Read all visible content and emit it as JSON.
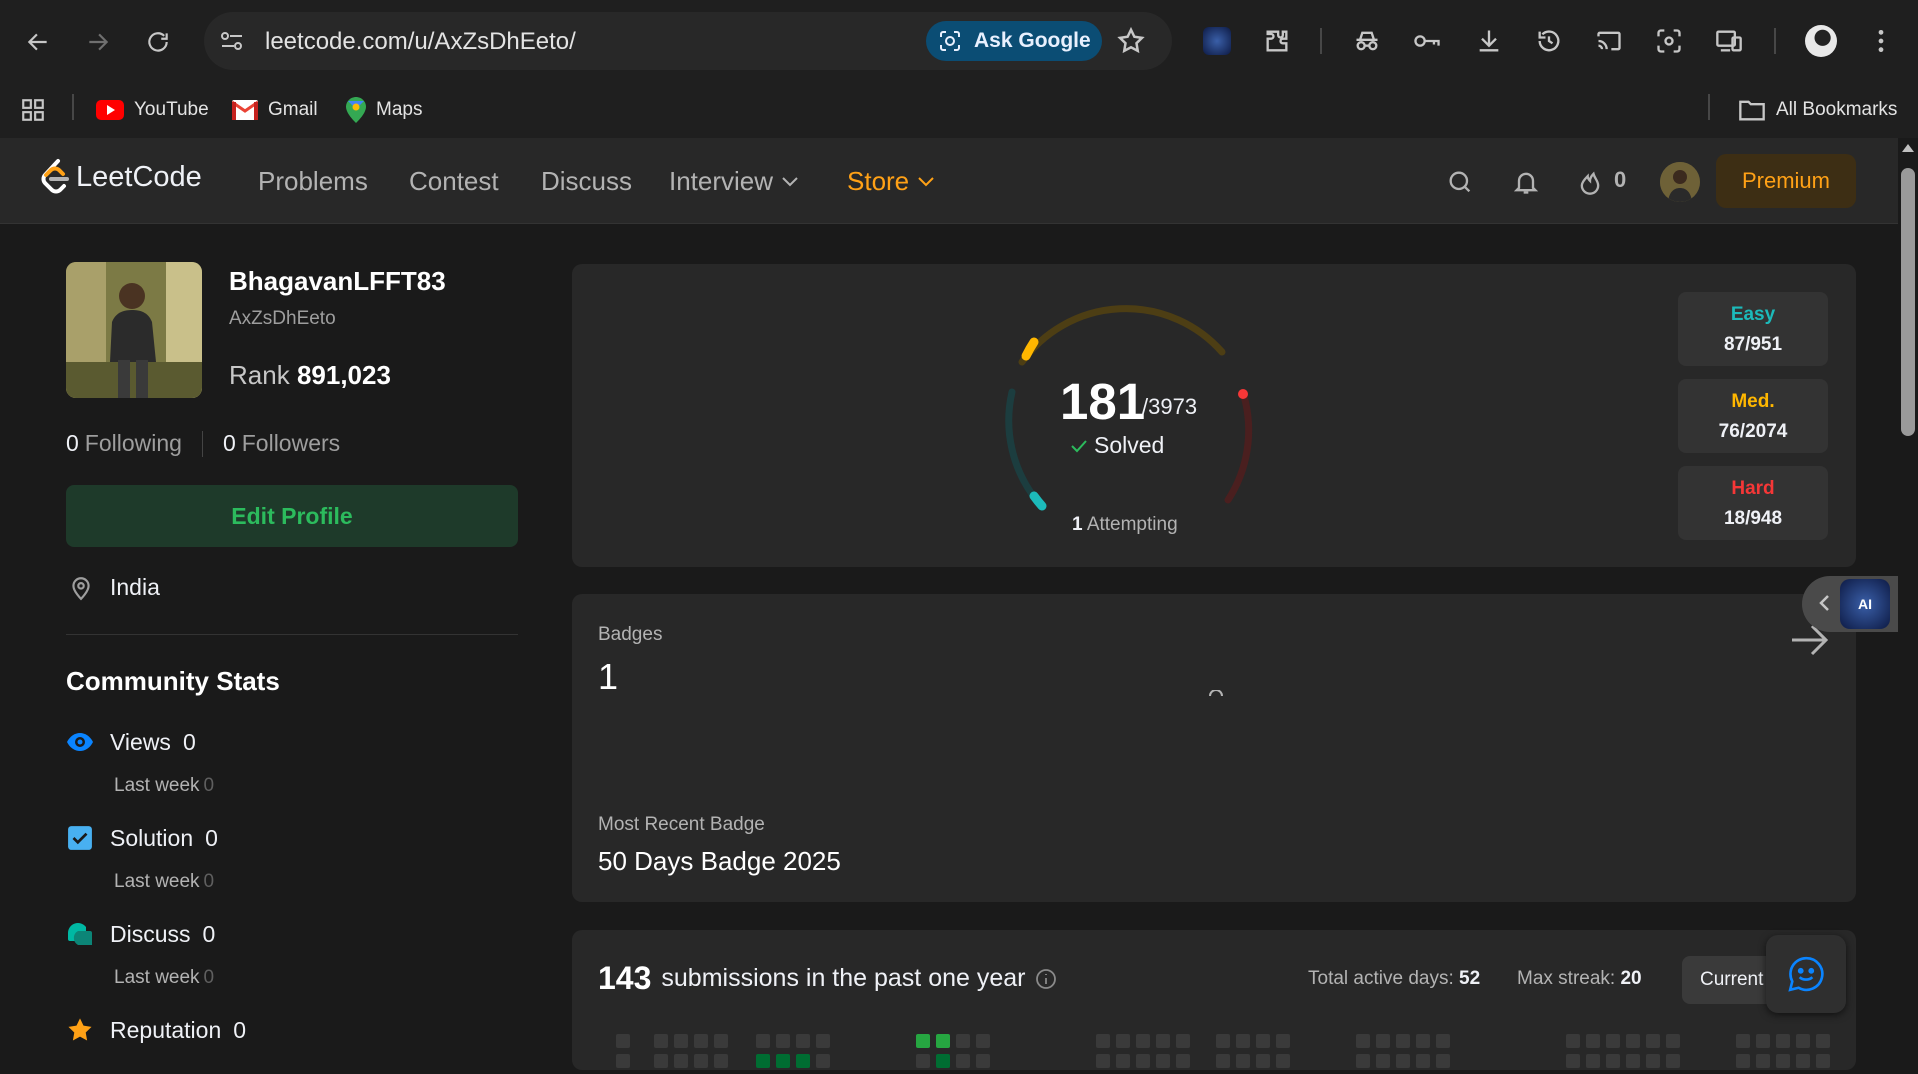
{
  "browser": {
    "url": "leetcode.com/u/AxZsDhEeto/",
    "ask_google": "Ask Google",
    "bookmarks": [
      {
        "label": "YouTube",
        "icon": "youtube-icon"
      },
      {
        "label": "Gmail",
        "icon": "gmail-icon"
      },
      {
        "label": "Maps",
        "icon": "maps-icon"
      }
    ],
    "all_bookmarks": "All Bookmarks"
  },
  "nav": {
    "logo": "LeetCode",
    "links": [
      "Problems",
      "Contest",
      "Discuss",
      "Interview",
      "Store"
    ],
    "streak": "0",
    "premium": "Premium"
  },
  "profile": {
    "name": "BhagavanLFFT83",
    "handle": "AxZsDhEeto",
    "rank_label": "Rank",
    "rank": "891,023",
    "following_count": "0",
    "following_label": "Following",
    "followers_count": "0",
    "followers_label": "Followers",
    "edit_profile": "Edit Profile",
    "location": "India"
  },
  "community": {
    "title": "Community Stats",
    "last_week_label": "Last week",
    "stats": [
      {
        "label": "Views",
        "value": "0",
        "last_week": "0",
        "color": "#0a84ff"
      },
      {
        "label": "Solution",
        "value": "0",
        "last_week": "0",
        "color": "#48b0f1"
      },
      {
        "label": "Discuss",
        "value": "0",
        "last_week": "0",
        "color": "#00b8a3"
      },
      {
        "label": "Reputation",
        "value": "0",
        "color": "#ffa116"
      }
    ]
  },
  "solved": {
    "count": "181",
    "total": "/3973",
    "label": "Solved",
    "attempting_count": "1",
    "attempting_label": "Attempting",
    "difficulty": [
      {
        "name": "Easy",
        "value": "87/951",
        "color": "#1cbaba"
      },
      {
        "name": "Med.",
        "value": "76/2074",
        "color": "#ffb700"
      },
      {
        "name": "Hard",
        "value": "18/948",
        "color": "#f63737"
      }
    ]
  },
  "badges": {
    "label": "Badges",
    "count": "1",
    "recent_label": "Most Recent Badge",
    "recent_name": "50 Days Badge 2025"
  },
  "submissions": {
    "count": "143",
    "label": "submissions in the past one year",
    "active_days_label": "Total active days:",
    "active_days": "52",
    "max_streak_label": "Max streak:",
    "max_streak": "20",
    "current_label": "Current"
  },
  "ai_widget": {
    "label": "AI"
  }
}
